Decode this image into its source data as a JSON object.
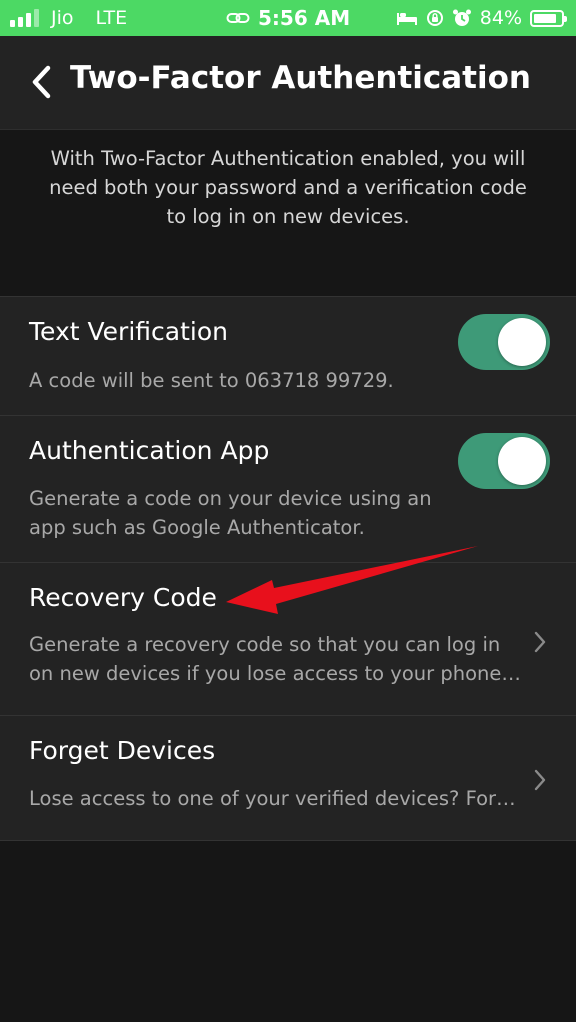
{
  "status_bar": {
    "carrier": "Jio",
    "network": "LTE",
    "time": "5:56 AM",
    "battery_percent": "84%",
    "battery_level": 0.84,
    "signal_bars_active": 3,
    "icons": [
      "link-icon",
      "bed-icon",
      "orientation-lock-icon",
      "alarm-icon"
    ]
  },
  "header": {
    "back_icon": "chevron-left-icon",
    "title": "Two-Factor Authentication"
  },
  "description": "With Two-Factor Authentication enabled, you will need both your password and a verification code to log in on new devices.",
  "settings": {
    "text_verification": {
      "title": "Text Verification",
      "subtitle": "A code will be sent to 063718 99729.",
      "enabled": true
    },
    "authentication_app": {
      "title": "Authentication App",
      "subtitle": "Generate a code on your device using an app such as Google Authenticator.",
      "enabled": true
    },
    "recovery_code": {
      "title": "Recovery Code",
      "subtitle": "Generate a recovery code so that you can log in on new devices if you lose access to your phone…"
    },
    "forget_devices": {
      "title": "Forget Devices",
      "subtitle": "Lose access to one of your verified devices? For…"
    }
  },
  "colors": {
    "status_bar": "#4cd964",
    "background": "#161616",
    "panel": "#232323",
    "toggle_on": "#3e9a78",
    "annotation_arrow": "#e8101c"
  }
}
